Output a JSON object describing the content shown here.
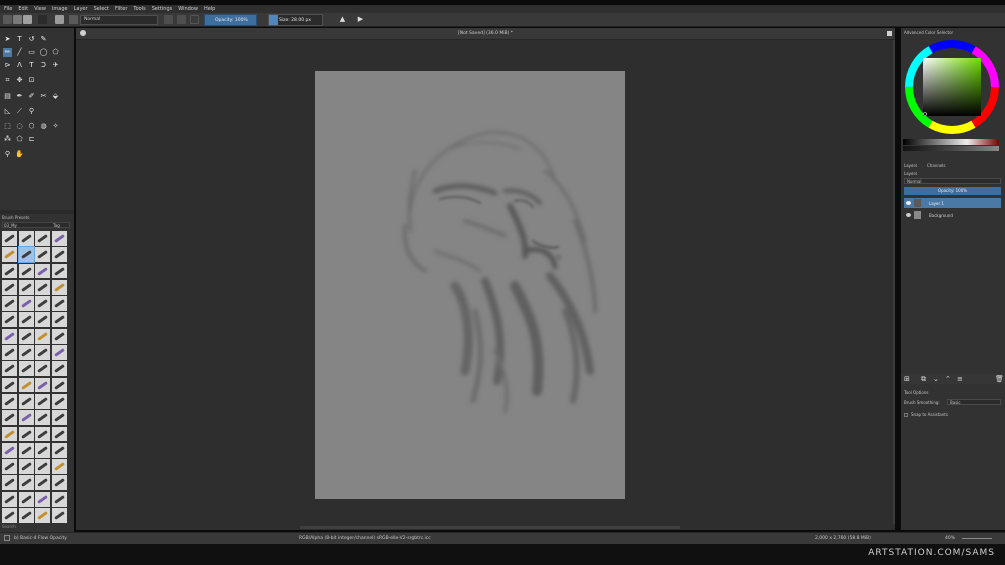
{
  "menubar": [
    "File",
    "Edit",
    "View",
    "Image",
    "Layer",
    "Select",
    "Filter",
    "Tools",
    "Settings",
    "Window",
    "Help"
  ],
  "toolbar": {
    "blend_mode": "Normal",
    "opacity_label": "Opacity: 100%",
    "size_label": "Size: 28.00 px"
  },
  "document": {
    "title": "[Not Saved]  (36.0 MiB) *"
  },
  "brush_presets": {
    "title": "Brush Presets",
    "tag": "03_My",
    "tag_button": "Tag",
    "search": "Search"
  },
  "color_selector": {
    "title": "Advanced Color Selector",
    "accent": "#3c6ea0"
  },
  "layers_panel": {
    "tabs": [
      "Layers",
      "Channels"
    ],
    "title": "Layers",
    "blend_mode": "Normal",
    "opacity_label": "Opacity: 100%",
    "layers": [
      {
        "name": "Layer 1",
        "selected": true
      },
      {
        "name": "Background",
        "selected": false
      }
    ]
  },
  "tool_options": {
    "title": "Tool Options",
    "smoothing_label": "Brush Smoothing:",
    "smoothing_value": "Basic",
    "snap_label": "Snap to Assistants"
  },
  "status": {
    "brush": "b) Basic-4 Flow Opacity",
    "color_space": "RGB/Alpha (8-bit integer/channel)  sRGB-elle-V2-srgbtrc.icc",
    "dimensions": "2,000 x 2,760 (58.8 MiB)",
    "zoom": "40%"
  },
  "watermark": "ARTSTATION.COM/SAMS"
}
